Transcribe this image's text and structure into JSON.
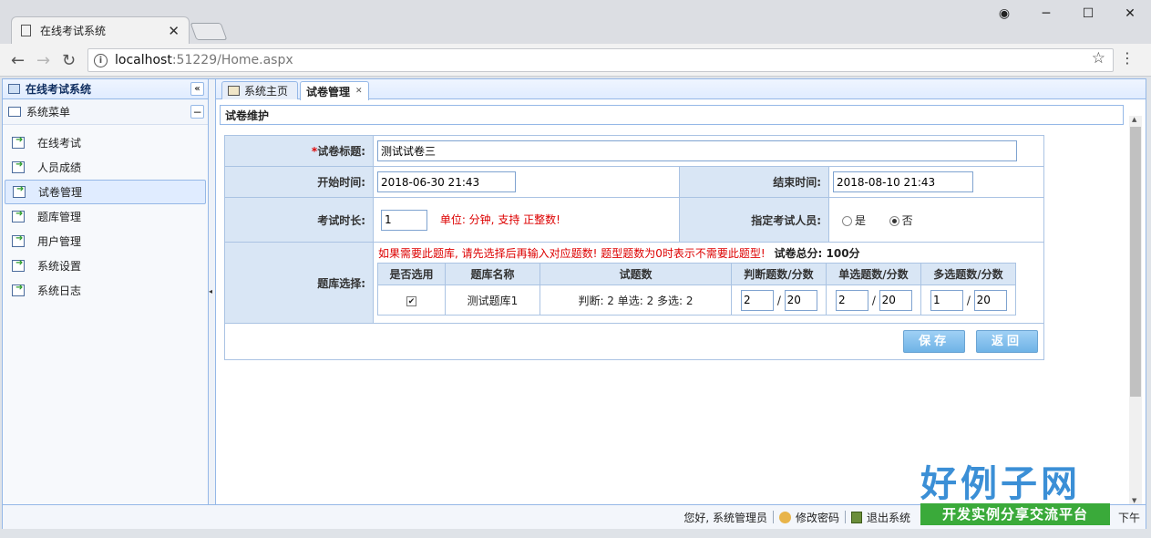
{
  "browser": {
    "tab_title": "在线考试系统",
    "close_glyph": "✕",
    "url_host": "localhost",
    "url_rest": ":51229/Home.aspx",
    "window_controls": [
      "◉",
      "─",
      "☐",
      "✕"
    ]
  },
  "sidebar": {
    "title": "在线考试系统",
    "section": "系统菜单",
    "items": [
      {
        "label": "在线考试"
      },
      {
        "label": "人员成绩"
      },
      {
        "label": "试卷管理"
      },
      {
        "label": "题库管理"
      },
      {
        "label": "用户管理"
      },
      {
        "label": "系统设置"
      },
      {
        "label": "系统日志"
      }
    ]
  },
  "tabs": [
    {
      "label": "系统主页"
    },
    {
      "label": "试卷管理"
    }
  ],
  "panel_title": "试卷维护",
  "form": {
    "title_label": "*试卷标题:",
    "title_value": "测试试卷三",
    "start_label": "*开始时间:",
    "start_value": "2018-06-30 21:43",
    "end_label": "*结束时间:",
    "end_value": "2018-08-10 21:43",
    "duration_label": "*考试时长:",
    "duration_value": "1",
    "duration_hint": "单位: 分钟, 支持 正整数!",
    "assign_label": "*指定考试人员:",
    "assign_options": [
      "是",
      "否"
    ],
    "assign_selected": "否",
    "bank_label": "*题库选择:",
    "bank_warning": "如果需要此题库, 请先选择后再输入对应题数! 题型题数为0时表示不需要此题型!",
    "total_label": "试卷总分: 100分",
    "bank_headers": [
      "是否选用",
      "题库名称",
      "试题数",
      "判断题数/分数",
      "单选题数/分数",
      "多选题数/分数"
    ],
    "bank_rows": [
      {
        "checked": true,
        "check_glyph": "✔",
        "name": "测试题库1",
        "counts": "判断: 2 单选: 2 多选: 2",
        "judge_num": "2",
        "judge_score": "20",
        "single_num": "2",
        "single_score": "20",
        "multi_num": "1",
        "multi_score": "20"
      }
    ],
    "save_label": "保存",
    "back_label": "返回"
  },
  "statusbar": {
    "greeting": "您好, 系统管理员",
    "change_pwd": "修改密码",
    "logout": "退出系统",
    "period": "下午"
  },
  "watermark": {
    "logo_big": "好例子网",
    "logo_sub": "开发实例分享交流平台"
  }
}
